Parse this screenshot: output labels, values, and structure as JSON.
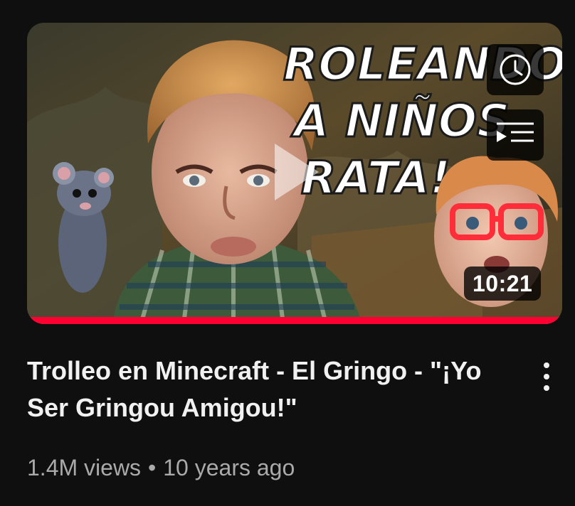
{
  "video": {
    "thumbnail_text": [
      "ROLEANDO",
      "A NIÑOS",
      "RATA!"
    ],
    "duration": "10:21",
    "watch_progress_fraction": 1.0,
    "title": "Trolleo en Minecraft - El Gringo - \"¡Yo Ser Gringou Amigou!\"",
    "views": "1.4M views",
    "separator": "•",
    "age": "10 years ago"
  },
  "actions": {
    "watch_later_icon": "clock-icon",
    "add_to_queue_icon": "queue-icon",
    "menu_icon": "more-vertical-icon"
  },
  "colors": {
    "background": "#0f0f0f",
    "progress": "#ff0033",
    "title": "#f1f1f1",
    "meta": "#aaaaaa"
  }
}
